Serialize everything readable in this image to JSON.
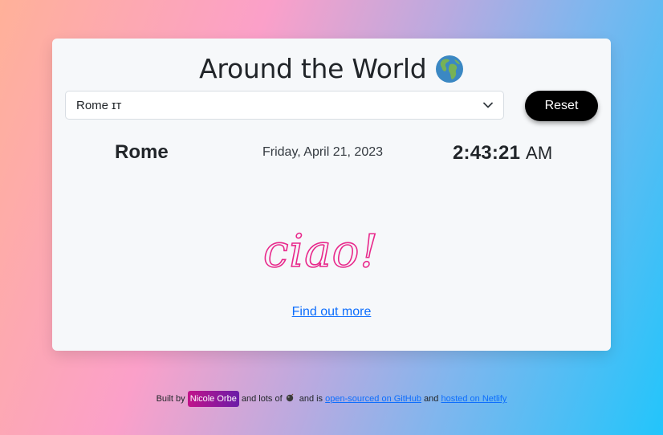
{
  "header": {
    "title": "Around the World",
    "globe_icon": "globe-europe-africa-icon"
  },
  "city_select": {
    "value": "Rome ɪᴛ",
    "chevron_icon": "chevron-down-icon"
  },
  "reset_button": {
    "label": "Reset"
  },
  "clock": {
    "city": "Rome",
    "date": "Friday, April 21, 2023",
    "time": "2:43:21",
    "ampm": "AM"
  },
  "greeting": {
    "text": "ciao!",
    "color": "#e8288b"
  },
  "find_out_more": {
    "label": "Find out more"
  },
  "footer": {
    "built_by": "Built by",
    "author": "Nicole Orbe",
    "and_lots_of": "and lots of",
    "icon": "bomb-icon",
    "and_is": "and is",
    "github_link": "open-sourced on GitHub",
    "and": "and",
    "netlify_link": "hosted on Netlify"
  },
  "colors": {
    "card_bg": "#f6f8fa",
    "button_bg": "#000000",
    "link": "#0d6efd",
    "badge_start": "#c2138a",
    "badge_end": "#6a1ca8"
  }
}
